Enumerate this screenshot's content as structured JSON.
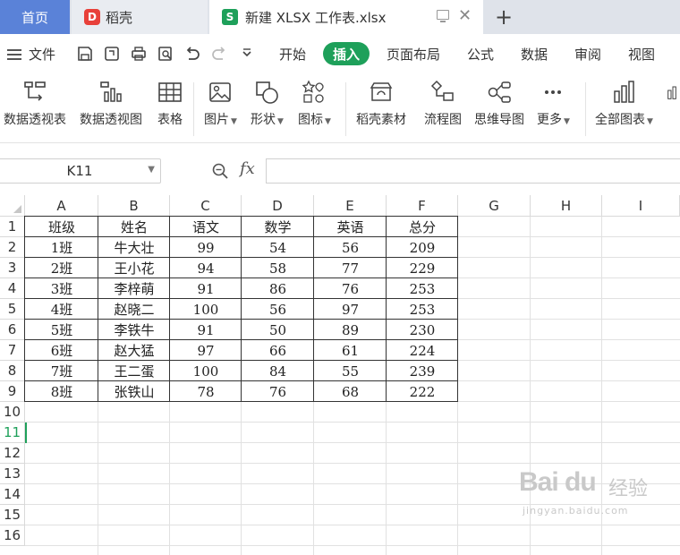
{
  "tabs": {
    "home": "首页",
    "docer": "稻壳",
    "docer_logo": "D",
    "doc_logo": "S",
    "document": "新建 XLSX 工作表.xlsx",
    "close": "✕",
    "add": "+"
  },
  "menu": {
    "file": "文件",
    "items": [
      "开始",
      "插入",
      "页面布局",
      "公式",
      "数据",
      "审阅",
      "视图"
    ],
    "active": "插入"
  },
  "ribbon": {
    "items": [
      {
        "label": "数据透视表",
        "icon": "pivot-table-icon"
      },
      {
        "label": "数据透视图",
        "icon": "pivot-chart-icon"
      },
      {
        "label": "表格",
        "icon": "table-icon"
      },
      {
        "label": "图片",
        "icon": "picture-icon",
        "dropdown": true
      },
      {
        "label": "形状",
        "icon": "shape-icon",
        "dropdown": true
      },
      {
        "label": "图标",
        "icon": "icons-icon",
        "dropdown": true
      },
      {
        "label": "稻壳素材",
        "icon": "docer-material-icon"
      },
      {
        "label": "流程图",
        "icon": "flowchart-icon"
      },
      {
        "label": "思维导图",
        "icon": "mindmap-icon"
      },
      {
        "label": "更多",
        "icon": "more-icon",
        "dropdown": true
      },
      {
        "label": "全部图表",
        "icon": "all-charts-icon",
        "dropdown": true
      }
    ]
  },
  "formula": {
    "name_box": "K11",
    "fx": "fx",
    "value": ""
  },
  "sheet": {
    "columns": [
      "A",
      "B",
      "C",
      "D",
      "E",
      "F",
      "G",
      "H",
      "I"
    ],
    "rows": [
      "1",
      "2",
      "3",
      "4",
      "5",
      "6",
      "7",
      "8",
      "9",
      "10",
      "11",
      "12",
      "13",
      "14",
      "15",
      "16"
    ],
    "selected_row": "11",
    "table": [
      [
        "班级",
        "姓名",
        "语文",
        "数学",
        "英语",
        "总分"
      ],
      [
        "1班",
        "牛大壮",
        "99",
        "54",
        "56",
        "209"
      ],
      [
        "2班",
        "王小花",
        "94",
        "58",
        "77",
        "229"
      ],
      [
        "3班",
        "李梓萌",
        "91",
        "86",
        "76",
        "253"
      ],
      [
        "4班",
        "赵晓二",
        "100",
        "56",
        "97",
        "253"
      ],
      [
        "5班",
        "李铁牛",
        "91",
        "50",
        "89",
        "230"
      ],
      [
        "6班",
        "赵大猛",
        "97",
        "66",
        "61",
        "224"
      ],
      [
        "7班",
        "王二蛋",
        "100",
        "84",
        "55",
        "239"
      ],
      [
        "8班",
        "张铁山",
        "78",
        "76",
        "68",
        "222"
      ]
    ]
  },
  "watermark": {
    "brand": "Bai du",
    "cn": "经验",
    "url": "jingyan.baidu.com"
  },
  "colors": {
    "accent": "#1ea05a",
    "home_tab": "#5a82d8"
  }
}
